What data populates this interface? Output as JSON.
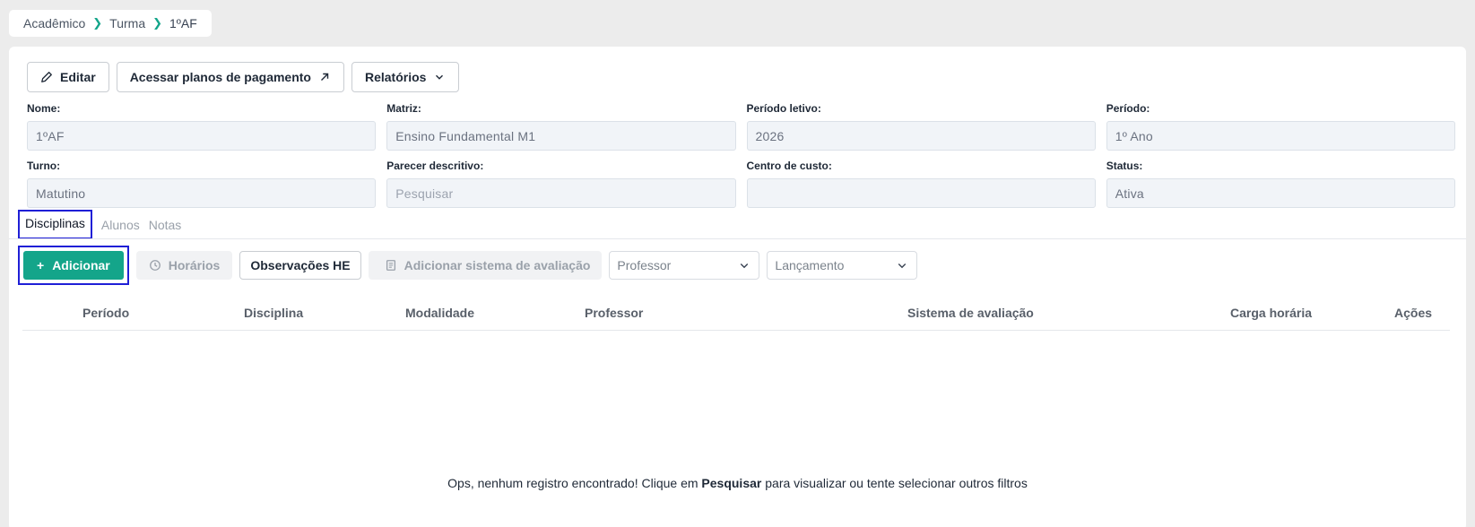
{
  "breadcrumb": {
    "items": [
      "Acadêmico",
      "Turma",
      "1ºAF"
    ]
  },
  "toolbar": {
    "edit_label": "Editar",
    "payment_plans_label": "Acessar planos de pagamento",
    "reports_label": "Relatórios"
  },
  "fields": {
    "nome": {
      "label": "Nome:",
      "value": "1ºAF"
    },
    "matriz": {
      "label": "Matriz:",
      "value": "Ensino Fundamental M1"
    },
    "periodo_letivo": {
      "label": "Período letivo:",
      "value": "2026"
    },
    "periodo": {
      "label": "Período:",
      "value": "1º Ano"
    },
    "turno": {
      "label": "Turno:",
      "value": "Matutino"
    },
    "parecer": {
      "label": "Parecer descritivo:",
      "placeholder": "Pesquisar"
    },
    "centro_custo": {
      "label": "Centro de custo:",
      "value": ""
    },
    "status": {
      "label": "Status:",
      "value": "Ativa"
    }
  },
  "tabs": [
    "Disciplinas",
    "Alunos",
    "Notas"
  ],
  "actions": {
    "add_label": "Adicionar",
    "schedules_label": "Horários",
    "observations_label": "Observações HE",
    "add_eval_system_label": "Adicionar sistema de avaliação",
    "professor_placeholder": "Professor",
    "lancamento_placeholder": "Lançamento"
  },
  "table": {
    "columns": [
      "Período",
      "Disciplina",
      "Modalidade",
      "Professor",
      "Sistema de avaliação",
      "Carga horária",
      "Ações"
    ]
  },
  "empty_state": {
    "before": "Ops, nenhum registro encontrado! Clique em ",
    "bold": "Pesquisar",
    "after": " para visualizar ou tente selecionar outros filtros"
  },
  "colors": {
    "accent": "#14a58a",
    "highlight": "#1f1fd6"
  }
}
